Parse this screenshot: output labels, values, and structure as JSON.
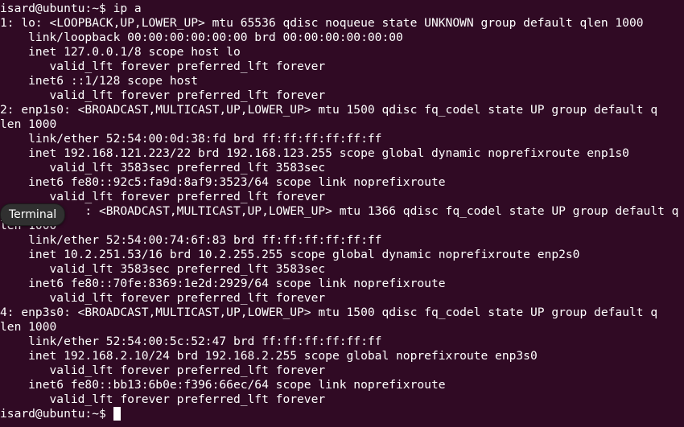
{
  "terminal": {
    "lines": [
      "isard@ubuntu:~$ ip a",
      "1: lo: <LOOPBACK,UP,LOWER_UP> mtu 65536 qdisc noqueue state UNKNOWN group default qlen 1000",
      "    link/loopback 00:00:00:00:00:00 brd 00:00:00:00:00:00",
      "    inet 127.0.0.1/8 scope host lo",
      "       valid_lft forever preferred_lft forever",
      "    inet6 ::1/128 scope host",
      "       valid_lft forever preferred_lft forever",
      "2: enp1s0: <BROADCAST,MULTICAST,UP,LOWER_UP> mtu 1500 qdisc fq_codel state UP group default q",
      "len 1000",
      "    link/ether 52:54:00:0d:38:fd brd ff:ff:ff:ff:ff:ff",
      "    inet 192.168.121.223/22 brd 192.168.123.255 scope global dynamic noprefixroute enp1s0",
      "       valid_lft 3583sec preferred_lft 3583sec",
      "    inet6 fe80::92c5:fa9d:8af9:3523/64 scope link noprefixroute",
      "       valid_lft forever preferred_lft forever",
      "            : <BROADCAST,MULTICAST,UP,LOWER_UP> mtu 1366 qdisc fq_codel state UP group default q",
      "len 1000",
      "    link/ether 52:54:00:74:6f:83 brd ff:ff:ff:ff:ff:ff",
      "    inet 10.2.251.53/16 brd 10.2.255.255 scope global dynamic noprefixroute enp2s0",
      "       valid_lft 3583sec preferred_lft 3583sec",
      "    inet6 fe80::70fe:8369:1e2d:2929/64 scope link noprefixroute",
      "       valid_lft forever preferred_lft forever",
      "4: enp3s0: <BROADCAST,MULTICAST,UP,LOWER_UP> mtu 1500 qdisc fq_codel state UP group default q",
      "len 1000",
      "    link/ether 52:54:00:5c:52:47 brd ff:ff:ff:ff:ff:ff",
      "    inet 192.168.2.10/24 brd 192.168.2.255 scope global noprefixroute enp3s0",
      "       valid_lft forever preferred_lft forever",
      "    inet6 fe80::bb13:6b0e:f396:66ec/64 scope link noprefixroute",
      "       valid_lft forever preferred_lft forever"
    ],
    "prompt": "isard@ubuntu:~$"
  },
  "tooltip": {
    "label": "Terminal"
  },
  "colors": {
    "background": "#300a24",
    "foreground": "#ffffff"
  }
}
